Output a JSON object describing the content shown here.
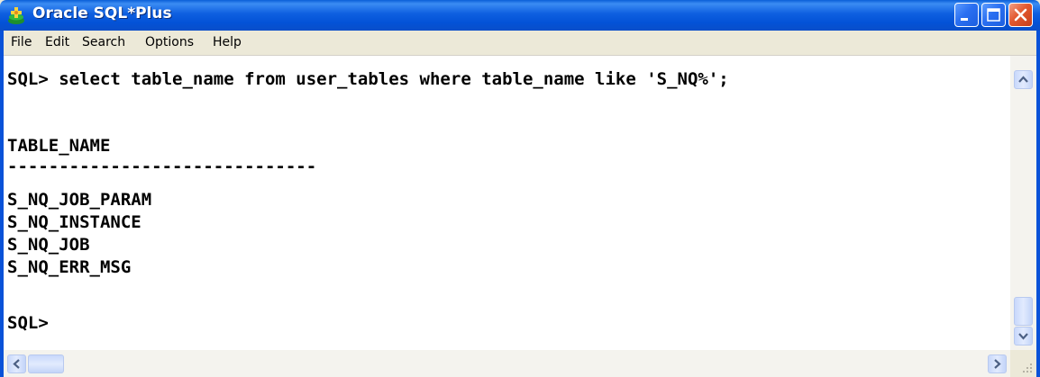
{
  "window": {
    "title": "Oracle SQL*Plus",
    "icon": "sqlplus-app-icon",
    "buttons": [
      "minimize-icon",
      "maximize-icon",
      "close-icon"
    ]
  },
  "menu": {
    "file": "File",
    "edit": "Edit",
    "search": "Search",
    "options": "Options",
    "help": "Help"
  },
  "console": {
    "lines": [
      "SQL> select table_name from user_tables where table_name like 'S_NQ%';",
      "TABLE_NAME",
      "------------------------------",
      "S_NQ_JOB_PARAM",
      "S_NQ_INSTANCE",
      "S_NQ_JOB",
      "S_NQ_ERR_MSG",
      "SQL>"
    ]
  },
  "colors": {
    "titlebar": "#0a5fd8",
    "close_button": "#e2582f",
    "menubar": "#ece9d8",
    "console_bg": "#ffffff",
    "console_text": "#000000"
  }
}
